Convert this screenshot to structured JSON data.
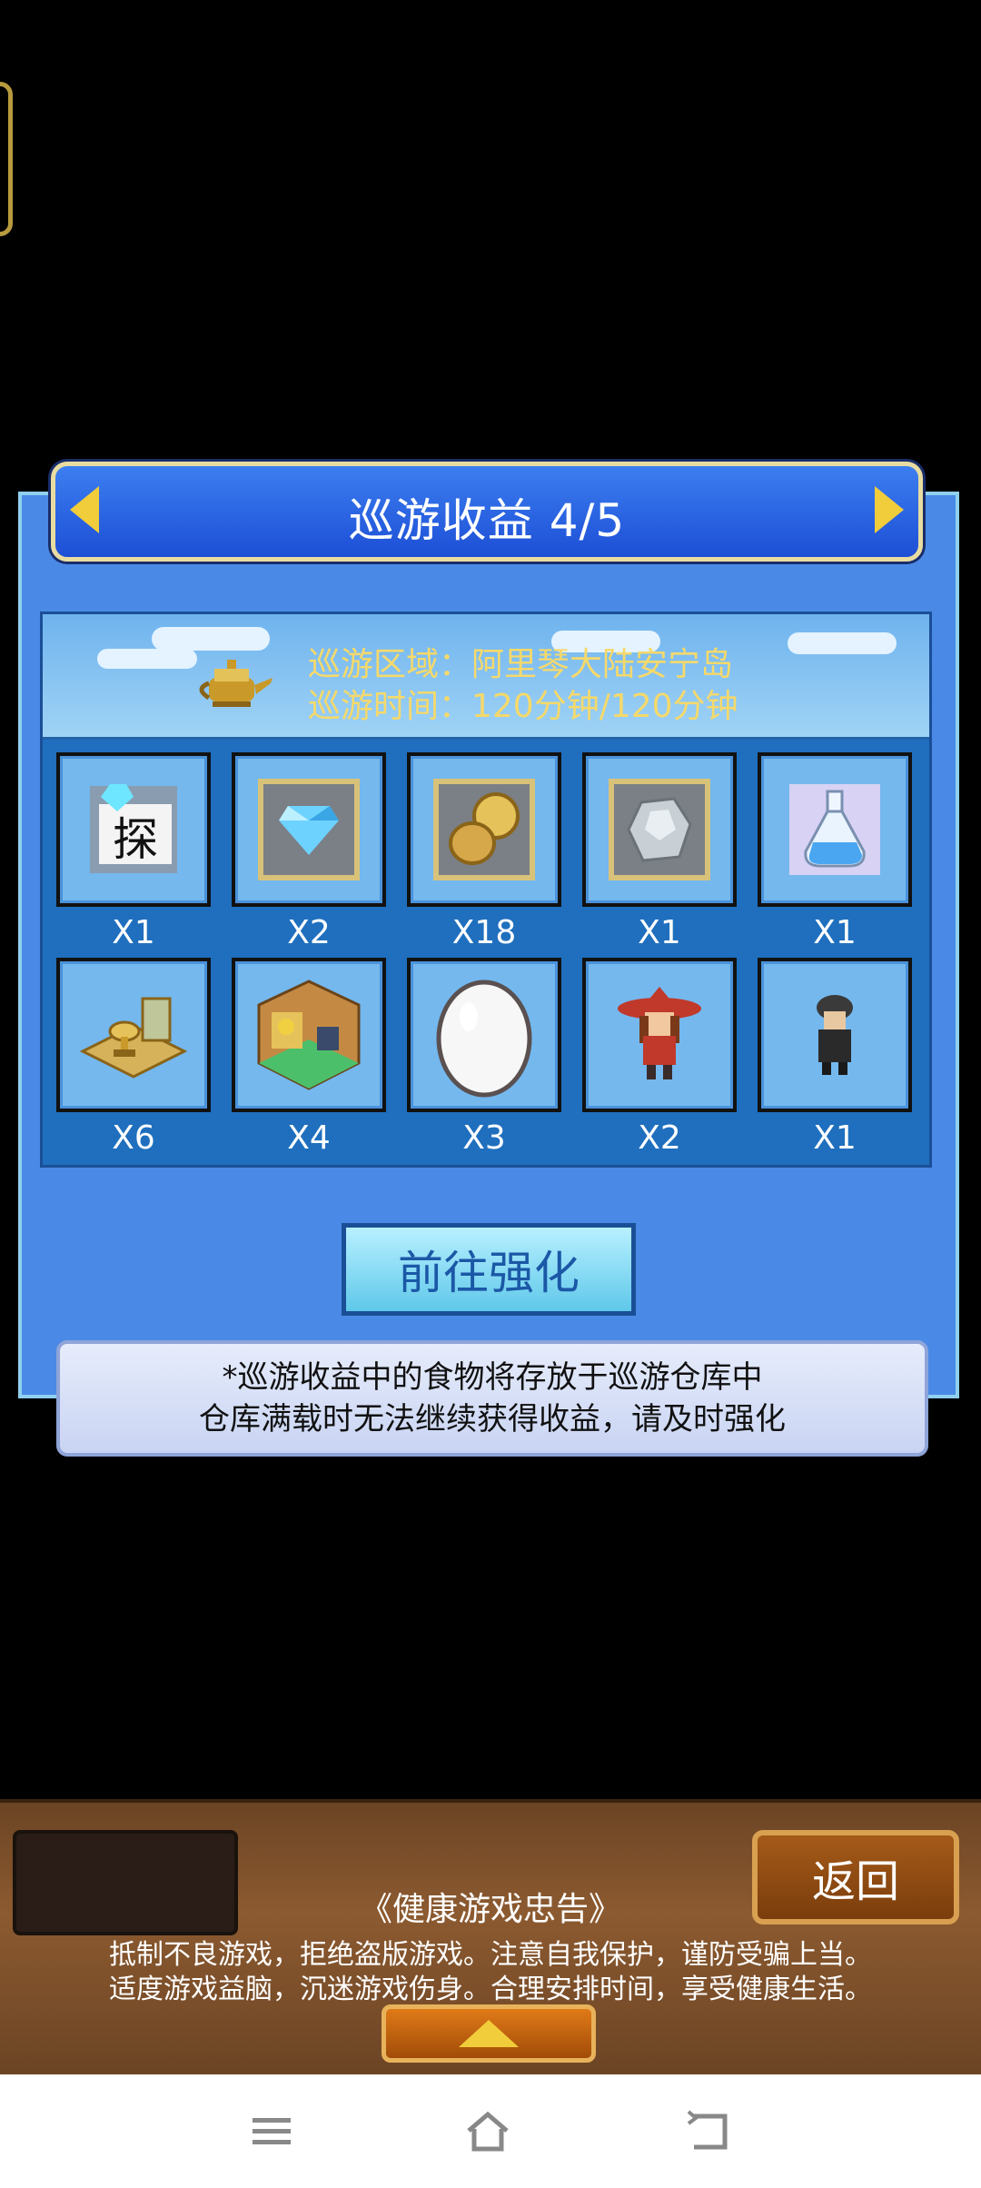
{
  "dialog": {
    "title": "巡游收益 4/5",
    "area_line": "巡游区域：阿里琴大陆安宁岛",
    "time_line": "巡游时间：120分钟/120分钟"
  },
  "rewards": [
    {
      "icon": "explore-ticket-icon",
      "count": "X1"
    },
    {
      "icon": "diamond-icon",
      "count": "X2"
    },
    {
      "icon": "coins-icon",
      "count": "X18"
    },
    {
      "icon": "ore-icon",
      "count": "X1"
    },
    {
      "icon": "potion-icon",
      "count": "X1"
    },
    {
      "icon": "trophy-room-icon",
      "count": "X6"
    },
    {
      "icon": "furnished-room-icon",
      "count": "X4"
    },
    {
      "icon": "egg-icon",
      "count": "X3"
    },
    {
      "icon": "red-hat-adventurer-icon",
      "count": "X2"
    },
    {
      "icon": "dark-cloak-adventurer-icon",
      "count": "X1"
    }
  ],
  "upgrade_button": "前往强化",
  "notice": {
    "line1": "*巡游收益中的食物将存放于巡游仓库中",
    "line2": "仓库满载时无法继续获得收益，请及时强化"
  },
  "footer": {
    "back_button": "返回",
    "health_title": "《健康游戏忠告》",
    "health_line1": "抵制不良游戏，拒绝盗版游戏。注意自我保护，谨防受骗上当。",
    "health_line2": "适度游戏益脑，沉迷游戏伤身。合理安排时间，享受健康生活。"
  },
  "colors": {
    "panel_blue": "#4a8ae6",
    "title_blue": "#1d4fd6",
    "info_gold": "#f6d96a",
    "wood": "#8c5a30"
  }
}
